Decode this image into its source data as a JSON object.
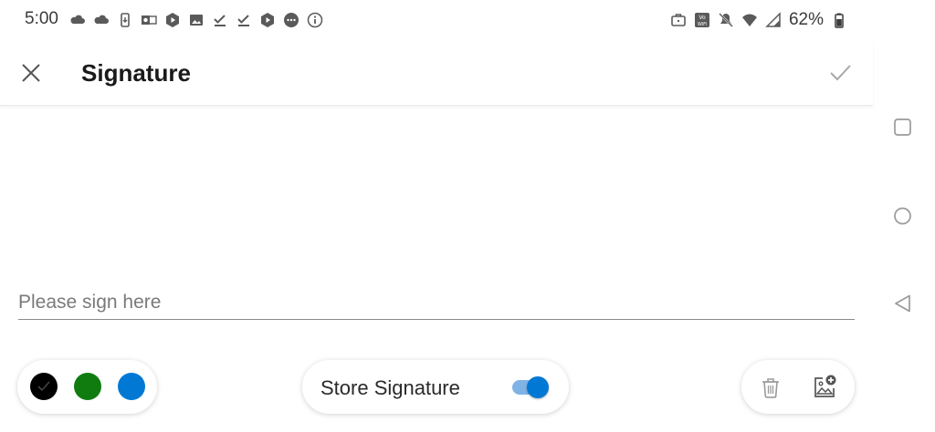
{
  "status_bar": {
    "time": "5:00",
    "battery_percent": "62%",
    "left_icons": [
      "cloud-icon",
      "cloud-icon",
      "phone-download-icon",
      "outlook-icon",
      "play-icon",
      "image-icon",
      "check-icon",
      "check-icon",
      "play-icon",
      "chat-icon",
      "info-icon"
    ],
    "right_icons": [
      "briefcase-icon",
      "vowifi-icon",
      "mute-icon",
      "wifi-icon",
      "signal-icon",
      "battery-icon"
    ]
  },
  "app_bar": {
    "title": "Signature",
    "close_icon": "close-icon",
    "confirm_icon": "check-icon"
  },
  "signature": {
    "placeholder": "Please sign here",
    "value": ""
  },
  "toolbar": {
    "colors": [
      {
        "name": "black",
        "hex": "#000000",
        "selected": true
      },
      {
        "name": "green",
        "hex": "#107c10",
        "selected": false
      },
      {
        "name": "blue",
        "hex": "#0078d4",
        "selected": false
      }
    ],
    "store_label": "Store Signature",
    "store_enabled": true,
    "accent": "#0078d4",
    "actions": [
      "trash-icon",
      "add-image-icon"
    ]
  },
  "nav_bar": {
    "buttons": [
      "recents-icon",
      "home-icon",
      "back-icon"
    ]
  }
}
